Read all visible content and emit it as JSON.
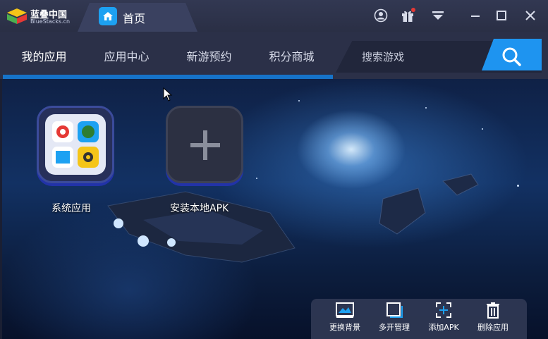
{
  "titlebar": {
    "logo_cn": "蓝叠中国",
    "logo_en": "BlueStacks.cn",
    "home_tab_label": "首页",
    "icons": [
      "account-icon",
      "gift-icon",
      "menu-dropdown-icon",
      "minimize-icon",
      "maximize-icon",
      "close-icon"
    ]
  },
  "nav": {
    "tabs": [
      {
        "label": "我的应用",
        "active": true
      },
      {
        "label": "应用中心",
        "active": false
      },
      {
        "label": "新游预约",
        "active": false
      },
      {
        "label": "积分商城",
        "active": false
      }
    ],
    "search_placeholder": "搜索游戏"
  },
  "apps": [
    {
      "label": "系统应用",
      "icon": "system-apps-icon"
    },
    {
      "label": "安装本地APK",
      "icon": "plus-icon"
    }
  ],
  "bottom_bar": {
    "items": [
      {
        "label": "更换背景",
        "icon": "wallpaper-icon"
      },
      {
        "label": "多开管理",
        "icon": "multi-instance-icon"
      },
      {
        "label": "添加APK",
        "icon": "add-apk-icon"
      },
      {
        "label": "删除应用",
        "icon": "trash-icon"
      }
    ]
  },
  "colors": {
    "accent": "#1e94f0",
    "tab_underline": "#1673c9",
    "titlebar": "#2a2f45",
    "navbar": "#2b3048"
  }
}
